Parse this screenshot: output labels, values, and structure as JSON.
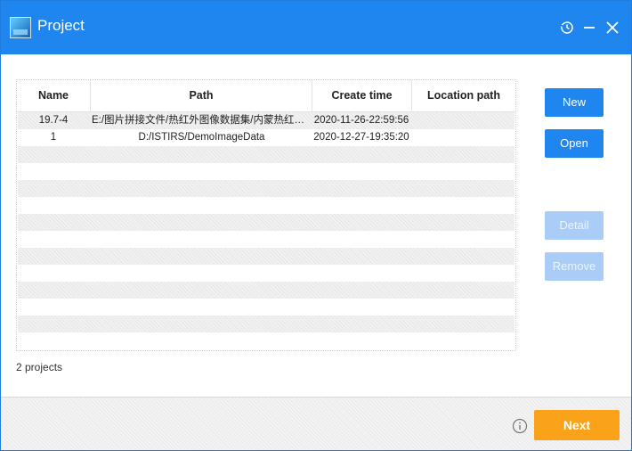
{
  "window": {
    "title": "Project",
    "titlebar_color": "#1f86f0"
  },
  "table": {
    "headers": [
      "Name",
      "Path",
      "Create time",
      "Location path"
    ],
    "rows": [
      {
        "name": "19.7-4",
        "path": "E:/图片拼接文件/热红外图像数据集/内蒙热红外...",
        "create_time": "2020-11-26-22:59:56",
        "location_path": ""
      },
      {
        "name": "1",
        "path": "D:/ISTIRS/DemoImageData",
        "create_time": "2020-12-27-19:35:20",
        "location_path": ""
      }
    ]
  },
  "buttons": {
    "new": "New",
    "open": "Open",
    "detail": "Detail",
    "remove": "Remove",
    "next": "Next"
  },
  "status": {
    "count_text": "2 projects"
  },
  "icons": {
    "app": "app-logo-icon",
    "history": "history-icon",
    "minimize": "minimize-icon",
    "close": "close-icon",
    "info": "info-icon"
  },
  "colors": {
    "primary": "#1f86f0",
    "disabled": "#a9cdf7",
    "accent": "#fba21b"
  }
}
